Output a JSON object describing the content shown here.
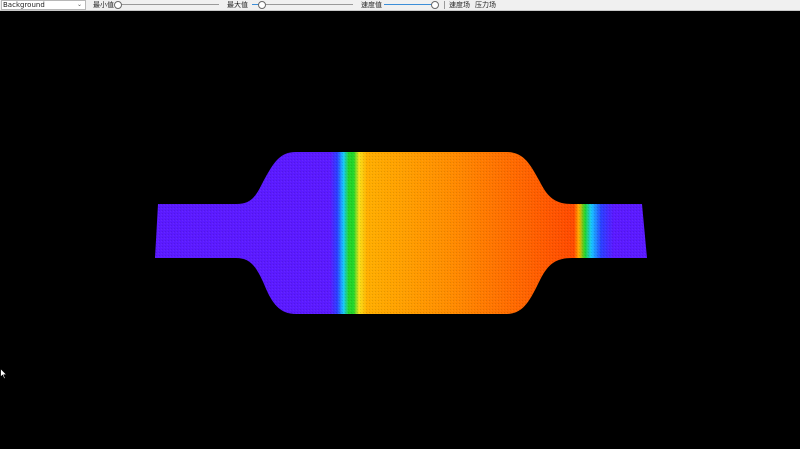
{
  "toolbar": {
    "display_select": {
      "value": "Background"
    },
    "min_label": "最小值",
    "min_slider": {
      "value_fraction": 0.0
    },
    "max_label": "最大值",
    "max_slider": {
      "value_fraction": 0.1
    },
    "speed_label": "速度值",
    "speed_slider": {
      "value_fraction": 1.0
    },
    "pressure_button": "速度场",
    "velocity_button": "压力场"
  },
  "scene": {
    "background_color": "#000000",
    "field_colors": {
      "low": "#5b1aff",
      "cyan": "#17c8ff",
      "green": "#22d62a",
      "yellow": "#f7e21a",
      "orange": "#ffae00",
      "high": "#ff4a00"
    }
  }
}
